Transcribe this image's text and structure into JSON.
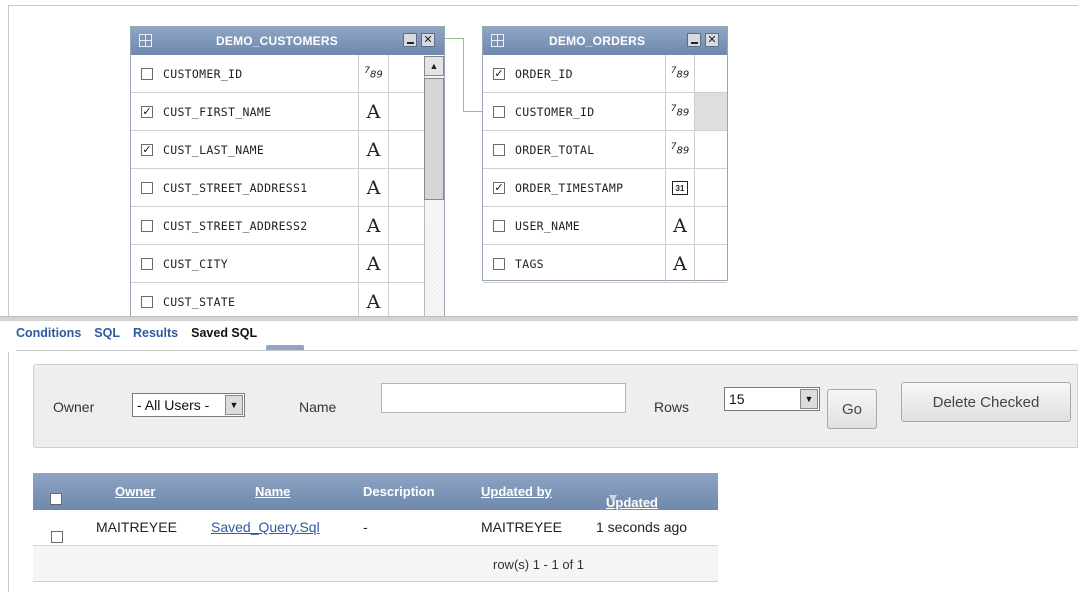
{
  "designer": {
    "customers_table": {
      "title": "DEMO_CUSTOMERS",
      "columns": [
        {
          "name": "CUSTOMER_ID",
          "checked": false,
          "type": "number-icon"
        },
        {
          "name": "CUST_FIRST_NAME",
          "checked": true,
          "type": "text-icon"
        },
        {
          "name": "CUST_LAST_NAME",
          "checked": true,
          "type": "text-icon"
        },
        {
          "name": "CUST_STREET_ADDRESS1",
          "checked": false,
          "type": "text-icon"
        },
        {
          "name": "CUST_STREET_ADDRESS2",
          "checked": false,
          "type": "text-icon"
        },
        {
          "name": "CUST_CITY",
          "checked": false,
          "type": "text-icon"
        },
        {
          "name": "CUST_STATE",
          "checked": false,
          "type": "text-icon"
        }
      ]
    },
    "orders_table": {
      "title": "DEMO_ORDERS",
      "columns": [
        {
          "name": "ORDER_ID",
          "checked": true,
          "type": "number-icon"
        },
        {
          "name": "CUSTOMER_ID",
          "checked": false,
          "type": "number-icon"
        },
        {
          "name": "ORDER_TOTAL",
          "checked": false,
          "type": "number-icon"
        },
        {
          "name": "ORDER_TIMESTAMP",
          "checked": true,
          "type": "date-icon"
        },
        {
          "name": "USER_NAME",
          "checked": false,
          "type": "text-icon"
        },
        {
          "name": "TAGS",
          "checked": false,
          "type": "text-icon"
        }
      ]
    },
    "type_glyphs": {
      "text": "A",
      "number": "789",
      "date": "31"
    },
    "check_glyph": "✓",
    "minimize_glyph": "",
    "close_glyph": "✕"
  },
  "tabs": {
    "conditions": "Conditions",
    "sql": "SQL",
    "results": "Results",
    "saved_sql": "Saved SQL",
    "active": "saved_sql"
  },
  "search": {
    "owner_label": "Owner",
    "owner_value": "- All Users -",
    "name_label": "Name",
    "name_value": "",
    "rows_label": "Rows",
    "rows_value": "15",
    "go_label": "Go",
    "delete_label": "Delete Checked",
    "dropdown_glyph": "▼"
  },
  "report": {
    "headers": {
      "owner": "Owner",
      "name": "Name",
      "description": "Description",
      "updated_by": "Updated by",
      "updated": "Updated"
    },
    "rows": [
      {
        "owner": "MAITREYEE",
        "name": "Saved_Query.Sql",
        "description": "-",
        "updated_by": "MAITREYEE",
        "updated": "1 seconds ago"
      }
    ],
    "pagination": "row(s) 1 - 1 of 1"
  },
  "colors": {
    "header_blue": "#7d95b8",
    "link_blue": "#2d5aa0",
    "join_line": "#8fc48f"
  }
}
